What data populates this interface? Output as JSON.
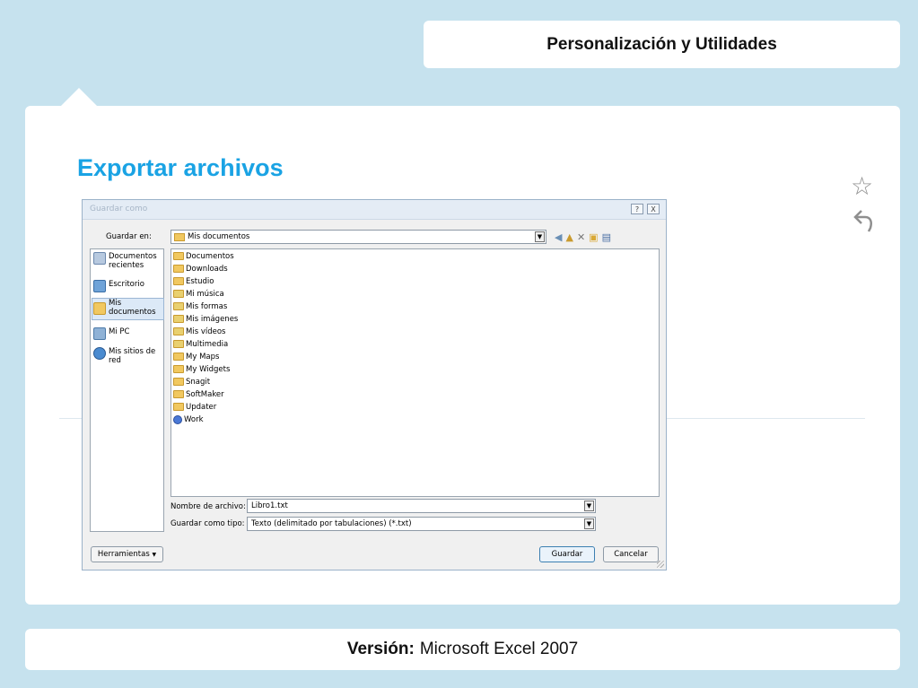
{
  "slide": {
    "header": "Personalización y Utilidades",
    "title": "Exportar archivos",
    "footer_label": "Versión:",
    "footer_value": "Microsoft Excel 2007"
  },
  "dialog": {
    "title": "Guardar como",
    "help_btn": "?",
    "close_btn": "X",
    "save_in_label": "Guardar en:",
    "save_in_value": "Mis documentos",
    "places": [
      {
        "label": "Documentos recientes",
        "icon": "recent-docs-icon"
      },
      {
        "label": "Escritorio",
        "icon": "desktop-icon"
      },
      {
        "label": "Mis documentos",
        "icon": "my-documents-icon"
      },
      {
        "label": "Mi PC",
        "icon": "my-computer-icon"
      },
      {
        "label": "Mis sitios de red",
        "icon": "network-places-icon"
      }
    ],
    "files": [
      "Documentos",
      "Downloads",
      "Estudio",
      "Mi música",
      "Mis formas",
      "Mis imágenes",
      "Mis vídeos",
      "Multimedia",
      "My Maps",
      "My Widgets",
      "Snagit",
      "SoftMaker",
      "Updater",
      "Work"
    ],
    "filename_label": "Nombre de archivo:",
    "filename_value": "Libro1.txt",
    "filetype_label": "Guardar como tipo:",
    "filetype_value": "Texto (delimitado por tabulaciones) (*.txt)",
    "tools_btn": "Herramientas",
    "save_btn": "Guardar",
    "cancel_btn": "Cancelar"
  },
  "colors": {
    "background": "#c6e2ee",
    "title_accent": "#1aa3e4"
  }
}
